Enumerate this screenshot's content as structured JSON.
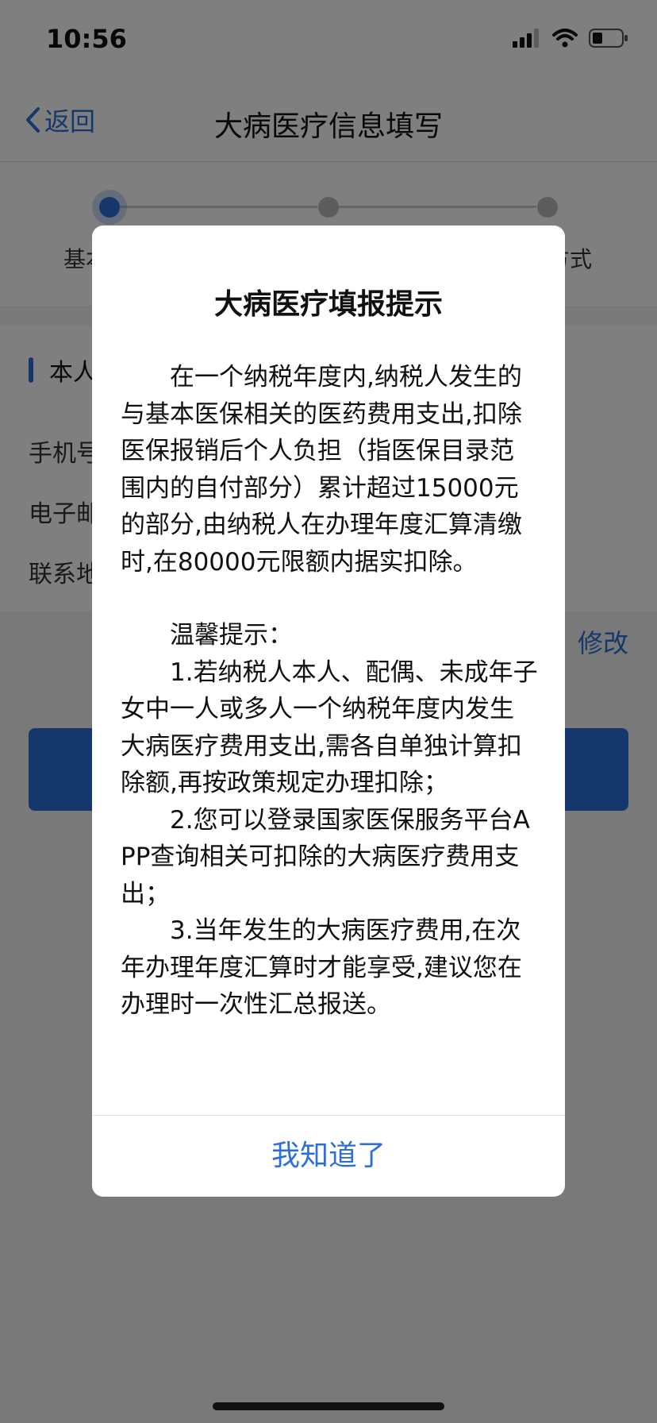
{
  "status_bar": {
    "time": "10:56"
  },
  "nav": {
    "back_label": "返回",
    "title": "大病医疗信息填写"
  },
  "steps": {
    "first_label": "基本",
    "last_label": "方式"
  },
  "section": {
    "heading": "本人",
    "fields": [
      "手机号",
      "电子邮",
      "联系地"
    ],
    "edit_label": "修改"
  },
  "dialog": {
    "title": "大病医疗填报提示",
    "paragraph_main": "在一个纳税年度内,纳税人发生的与基本医保相关的医药费用支出,扣除医保报销后个人负担（指医保目录范围内的自付部分）累计超过15000元的部分,由纳税人在办理年度汇算清缴时,在80000元限额内据实扣除。",
    "tip_heading": "温馨提示：",
    "tip_1": "1.若纳税人本人、配偶、未成年子女中一人或多人一个纳税年度内发生大病医疗费用支出,需各自单独计算扣除额,再按政策规定办理扣除；",
    "tip_2": "2.您可以登录国家医保服务平台APP查询相关可扣除的大病医疗费用支出；",
    "tip_3": "3.当年发生的大病医疗费用,在次年办理年度汇算时才能享受,建议您在办理时一次性汇总报送。",
    "confirm_label": "我知道了"
  }
}
